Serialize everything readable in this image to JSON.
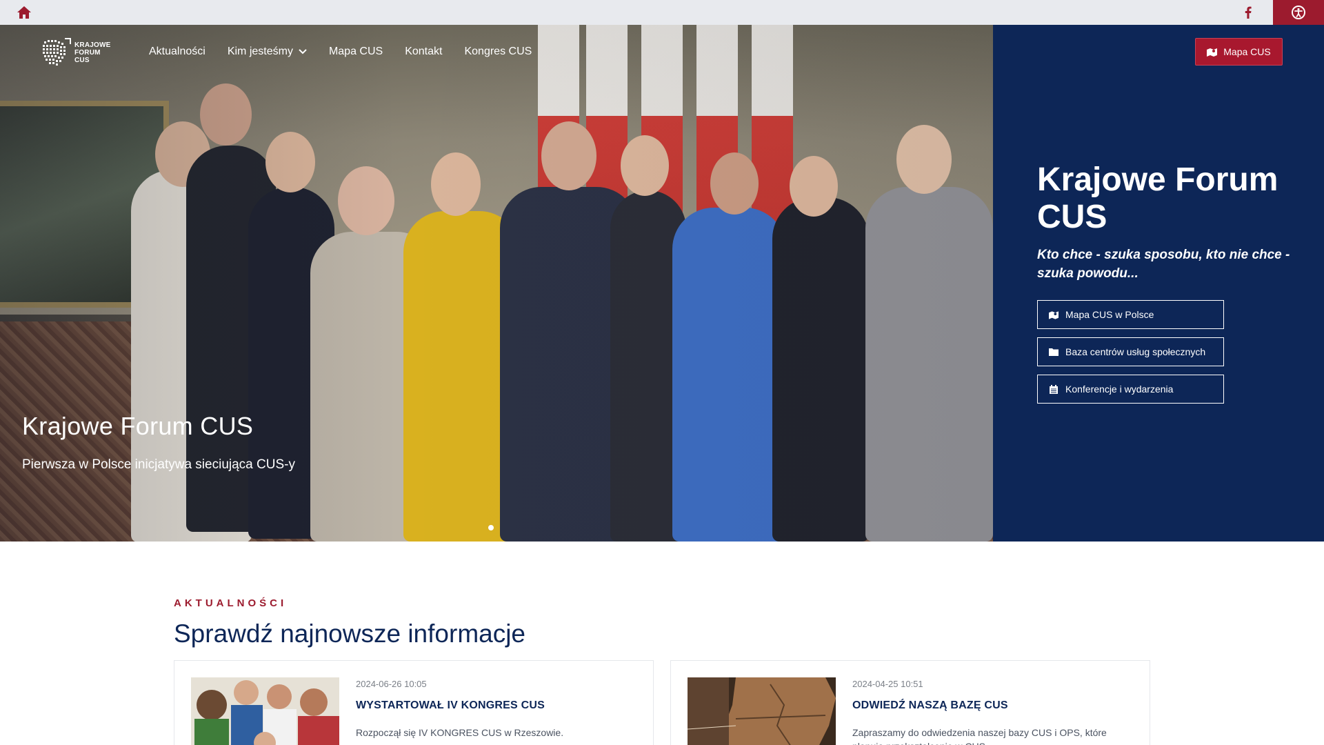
{
  "topbar": {
    "home_icon": "home-icon",
    "facebook_icon": "facebook-icon",
    "accessibility_icon": "accessibility-icon",
    "colors": {
      "bar": "#e8eaee",
      "accent": "#9c1b2e"
    }
  },
  "nav": {
    "logo_text": [
      "KRAJOWE",
      "FORUM",
      "CUS"
    ],
    "items": [
      {
        "label": "Aktualności"
      },
      {
        "label": "Kim jesteśmy",
        "has_dropdown": true
      },
      {
        "label": "Mapa CUS"
      },
      {
        "label": "Kontakt"
      },
      {
        "label": "Kongres CUS"
      }
    ],
    "cta_label": "Mapa CUS",
    "cta_icon": "map-icon"
  },
  "hero": {
    "caption_title": "Krajowe Forum CUS",
    "caption_subtitle": "Pierwsza w Polsce inicjatywa sieciująca CUS-y",
    "slides_count": 1,
    "active_slide": 1,
    "panel": {
      "title": "Krajowe Forum CUS",
      "motto": "Kto chce - szuka sposobu, kto nie chce - szuka powodu...",
      "buttons": [
        {
          "label": "Mapa CUS w Polsce",
          "icon": "map-icon"
        },
        {
          "label": "Baza centrów usług społecznych",
          "icon": "folder-icon"
        },
        {
          "label": "Konferencje i wydarzenia",
          "icon": "calendar-icon"
        }
      ],
      "color": "#0d2657"
    }
  },
  "news": {
    "kicker": "AKTUALNOŚCI",
    "title": "Sprawdź najnowsze informacje",
    "cards": [
      {
        "date": "2024-06-26 10:05",
        "title": "WYSTARTOWAŁ IV KONGRES CUS",
        "excerpt": "Rozpoczął się IV KONGRES CUS w Rzeszowie."
      },
      {
        "date": "2024-04-25 10:51",
        "title": "ODWIEDŹ NASZĄ BAZĘ CUS",
        "excerpt": "Zapraszamy do odwiedzenia naszej bazy CUS i OPS, które planują przekształcenie w CUS."
      }
    ]
  }
}
